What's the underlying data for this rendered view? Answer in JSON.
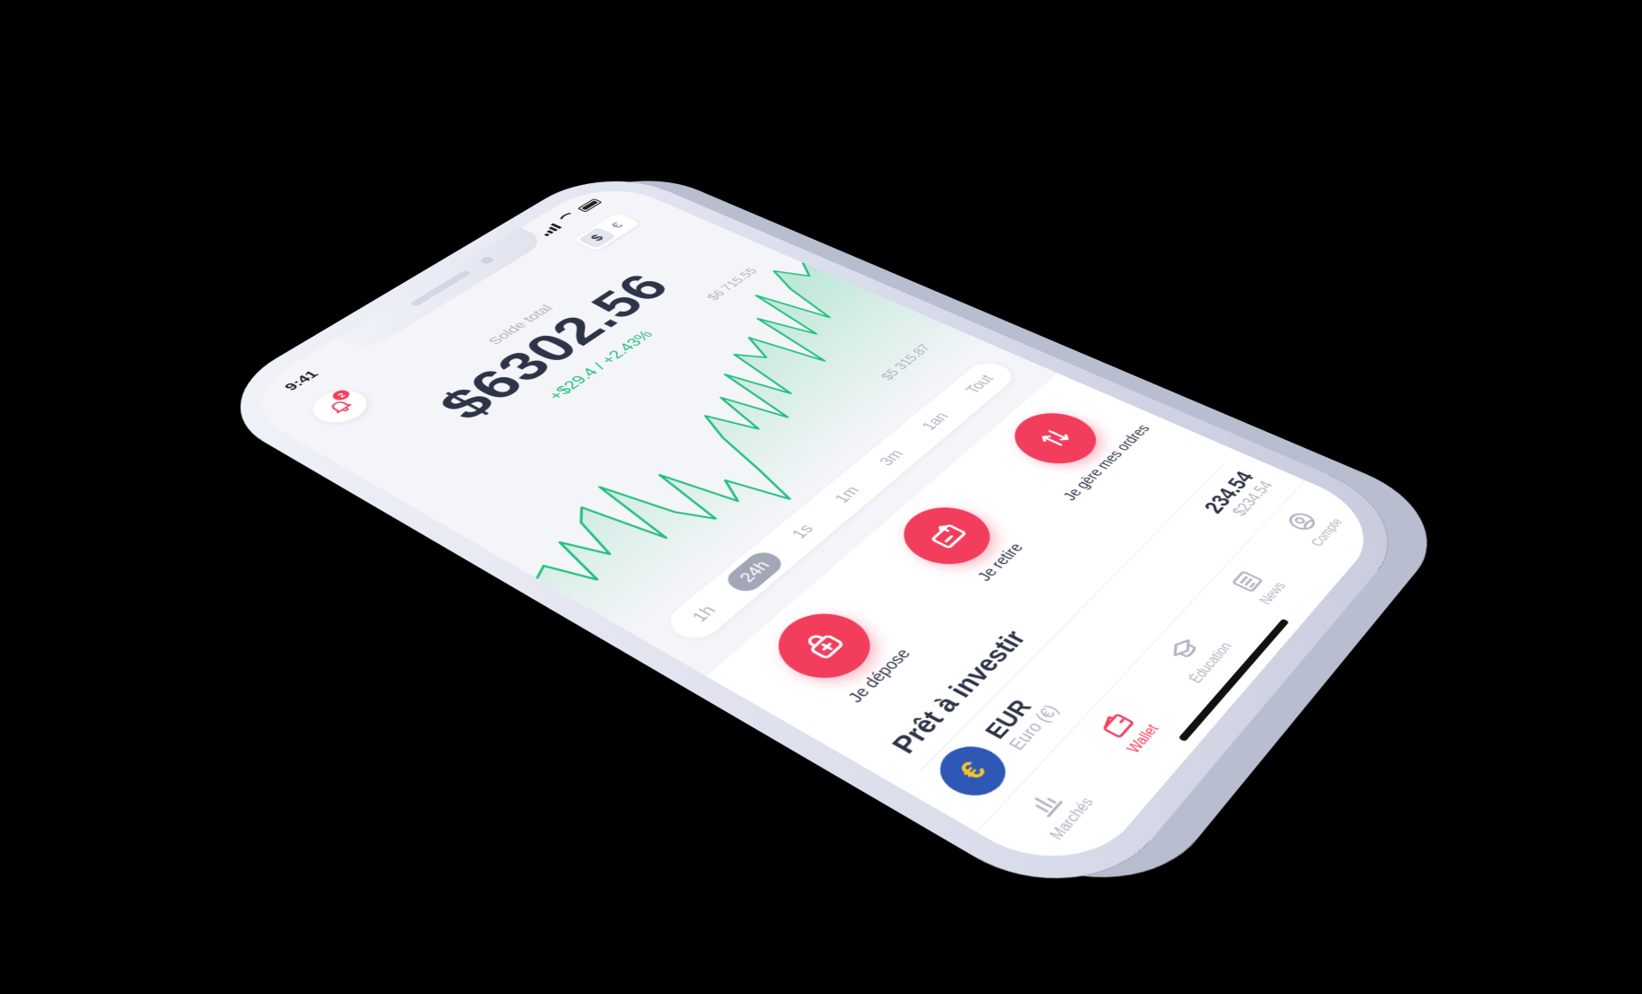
{
  "status": {
    "time": "9:41"
  },
  "currency_toggle": {
    "options": [
      "$",
      "€"
    ],
    "selected": "$"
  },
  "notifications": {
    "count": "2"
  },
  "balance": {
    "label": "Solde total",
    "value": "$6302.56",
    "change": "+$29.4 / +2.43%"
  },
  "chart_labels": {
    "max": "$6 715.55",
    "min": "$5 315.87"
  },
  "chart_series": [
    60,
    62,
    48,
    65,
    52,
    66,
    70,
    45,
    72,
    50,
    40,
    63,
    40,
    48,
    30,
    44,
    60,
    70,
    55,
    72,
    52,
    78,
    58,
    82,
    74,
    84,
    60,
    88,
    70,
    96,
    72,
    90,
    100,
    90,
    96
  ],
  "ranges": {
    "items": [
      "1h",
      "24h",
      "1s",
      "1m",
      "3m",
      "1an",
      "Tout"
    ],
    "selected": "24h"
  },
  "actions": [
    {
      "label": "Je dépose",
      "icon": "deposit-icon"
    },
    {
      "label": "Je retire",
      "icon": "withdraw-icon"
    },
    {
      "label": "Je gère mes ordres",
      "icon": "orders-icon"
    }
  ],
  "section": {
    "title": "Prêt à investir"
  },
  "asset": {
    "symbol": "€",
    "code": "EUR",
    "name": "Euro (€)",
    "value": "234.54",
    "value_usd": "$234.54"
  },
  "tabs": [
    {
      "label": "Marchés",
      "icon": "markets-icon"
    },
    {
      "label": "Wallet",
      "icon": "wallet-icon",
      "active": true
    },
    {
      "label": "Éducation",
      "icon": "education-icon"
    },
    {
      "label": "News",
      "icon": "news-icon"
    },
    {
      "label": "Compte",
      "icon": "account-icon"
    }
  ],
  "colors": {
    "accent": "#f23d5c",
    "positive": "#1fbf7a",
    "text": "#2e3448",
    "muted": "#b0b4c2"
  }
}
